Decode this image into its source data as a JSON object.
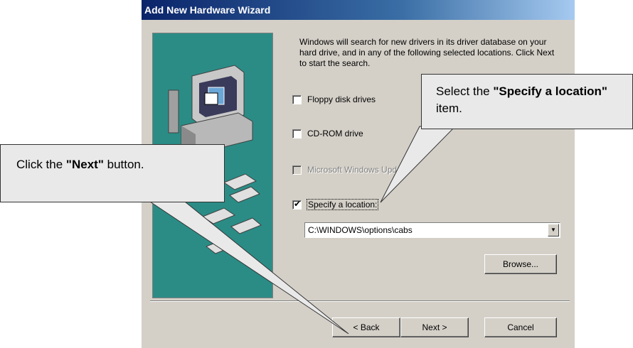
{
  "window": {
    "title": "Add New Hardware Wizard"
  },
  "description": "Windows will search for new drivers in its driver database on your hard drive, and in any of the following selected locations. Click Next to start the search.",
  "options": [
    {
      "label": "Floppy disk drives",
      "checked": false,
      "enabled": true
    },
    {
      "label": "CD-ROM drive",
      "checked": false,
      "enabled": true
    },
    {
      "label": "Microsoft Windows Update",
      "checked": false,
      "enabled": false
    },
    {
      "label": "Specify a location:",
      "checked": true,
      "enabled": true
    }
  ],
  "location": {
    "value": "C:\\WINDOWS\\options\\cabs"
  },
  "buttons": {
    "browse": "Browse...",
    "back": "< Back",
    "next": "Next >",
    "cancel": "Cancel"
  },
  "callouts": {
    "specify": {
      "before": "Select the ",
      "bold": "\"Specify a location\"",
      "after": " item."
    },
    "next": {
      "before": "Click the ",
      "bold": "\"Next\"",
      "after": " button."
    }
  }
}
